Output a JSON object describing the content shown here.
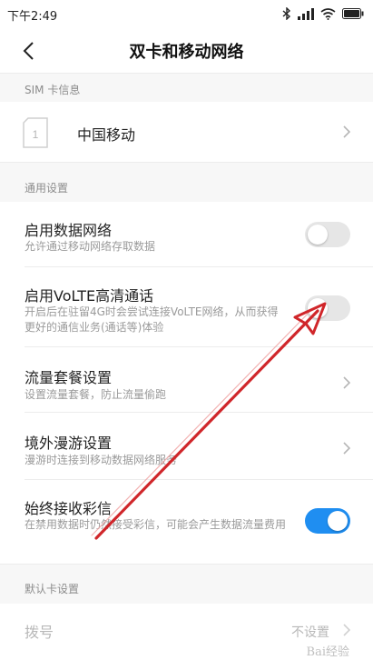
{
  "status_bar": {
    "time": "下午2:49"
  },
  "header": {
    "title": "双卡和移动网络"
  },
  "sections": {
    "sim": {
      "title": "SIM 卡信息",
      "card_label": "中国移动",
      "card_slot": "1"
    },
    "general": {
      "title": "通用设置",
      "items": [
        {
          "title": "启用数据网络",
          "subtitle": "允许通过移动网络存取数据",
          "control": "toggle",
          "value": false
        },
        {
          "title": "启用VoLTE高清通话",
          "subtitle": "开启后在驻留4G时会尝试连接VoLTE网络，从而获得更好的通信业务(通话等)体验",
          "control": "toggle",
          "value": false
        },
        {
          "title": "流量套餐设置",
          "subtitle": "设置流量套餐，防止流量偷跑",
          "control": "chevron"
        },
        {
          "title": "境外漫游设置",
          "subtitle": "漫游时连接到移动数据网络服务",
          "control": "chevron"
        },
        {
          "title": "始终接收彩信",
          "subtitle": "在禁用数据时仍然接受彩信，可能会产生数据流量费用",
          "control": "toggle",
          "value": true
        }
      ]
    },
    "default_card": {
      "title": "默认卡设置",
      "items": [
        {
          "title": "拨号",
          "value": "不设置",
          "control": "chevron"
        }
      ]
    }
  },
  "watermark": "Bai经验",
  "colors": {
    "accent": "#1f8ef1",
    "arrow": "#d0262a",
    "section_bg": "#f7f7f7"
  }
}
